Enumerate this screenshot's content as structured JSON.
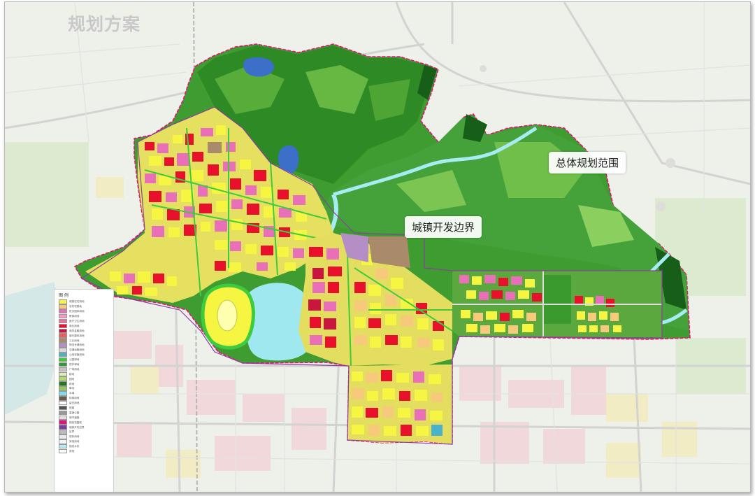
{
  "map": {
    "title": "规划方案",
    "label_master_plan": "总体规划范围",
    "label_dev_boundary": "城镇开发边界"
  },
  "legend": {
    "heading": "图 例",
    "items": [
      {
        "label": "城镇住宅用地",
        "color": "#f5f542"
      },
      {
        "label": "农村宅基地",
        "color": "#f7c97a"
      },
      {
        "label": "机关团体用地",
        "color": "#ea6fb9"
      },
      {
        "label": "教育用地",
        "color": "#f29ac7"
      },
      {
        "label": "医疗卫生用地",
        "color": "#f06e9a"
      },
      {
        "label": "商业用地",
        "color": "#e8102a"
      },
      {
        "label": "商务金融用地",
        "color": "#c9163f"
      },
      {
        "label": "娱乐康体用地",
        "color": "#ef5a5a"
      },
      {
        "label": "工业用地",
        "color": "#a98a6a"
      },
      {
        "label": "物流仓储用地",
        "color": "#b58ec6"
      },
      {
        "label": "交通运输用地",
        "color": "#d9d9d9"
      },
      {
        "label": "公用设施用地",
        "color": "#49b3c9"
      },
      {
        "label": "公园绿地",
        "color": "#3ecb3e"
      },
      {
        "label": "防护绿地",
        "color": "#2e9b2e"
      },
      {
        "label": "广场用地",
        "color": "#c5c5c5"
      },
      {
        "label": "耕地",
        "color": "#d9efb5"
      },
      {
        "label": "园地",
        "color": "#b5d86b"
      },
      {
        "label": "林地",
        "color": "#1f7a1f"
      },
      {
        "label": "草地",
        "color": "#95c75a"
      },
      {
        "label": "水域",
        "color": "#7fdcf2"
      },
      {
        "label": "特殊用地",
        "color": "#6a5a47"
      },
      {
        "label": "留白用地",
        "color": "#ffffff"
      },
      {
        "label": "铁路",
        "color": "#555555"
      },
      {
        "label": "高速公路",
        "color": "#999999"
      },
      {
        "label": "城市道路",
        "color": "#e0e0e0"
      },
      {
        "label": "规划范围线",
        "color": "#e8117a"
      },
      {
        "label": "城镇开发边界",
        "color": "#7a3fa0"
      },
      {
        "label": "区界",
        "color": "#bbbbbb"
      },
      {
        "label": "现状用地",
        "color": "#eaeaea"
      },
      {
        "label": "其他用地",
        "color": "#f5f5f5"
      },
      {
        "label": "规划水系",
        "color": "#b9ecf7"
      },
      {
        "label": "其他",
        "color": "#fafafa"
      }
    ]
  },
  "colors": {
    "forest_dark": "#1f7a1f",
    "forest": "#3a9a2e",
    "forest_light": "#7cbd4a",
    "water": "#9fe8f0",
    "residential": "#f5f542",
    "commercial": "#e8102a",
    "public": "#ea6fb9",
    "boundary_pink": "#e8117a",
    "boundary_purple": "#8b3fa0",
    "background": "#eef0ea"
  }
}
